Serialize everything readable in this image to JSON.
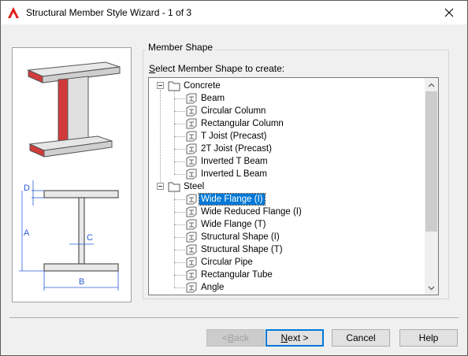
{
  "window": {
    "title": "Structural Member Style Wizard - 1 of 3",
    "close_glyph": "✕"
  },
  "preview": {
    "dimension_labels": {
      "d": "D",
      "a": "A",
      "c": "C",
      "b": "B"
    }
  },
  "group": {
    "title": "Member Shape",
    "list_label_prefix": "",
    "list_label_mnemonic": "S",
    "list_label_rest": "elect Member Shape to create:"
  },
  "tree": {
    "nodes": [
      {
        "label": "Concrete",
        "type": "category",
        "expanded": true
      },
      {
        "label": "Beam",
        "type": "shape"
      },
      {
        "label": "Circular Column",
        "type": "shape"
      },
      {
        "label": "Rectangular Column",
        "type": "shape"
      },
      {
        "label": "T Joist (Precast)",
        "type": "shape"
      },
      {
        "label": "2T Joist (Precast)",
        "type": "shape"
      },
      {
        "label": "Inverted T Beam",
        "type": "shape"
      },
      {
        "label": "Inverted L Beam",
        "type": "shape"
      },
      {
        "label": "Steel",
        "type": "category",
        "expanded": true
      },
      {
        "label": "Wide Flange (I)",
        "type": "shape",
        "selected": true
      },
      {
        "label": "Wide Reduced Flange (I)",
        "type": "shape"
      },
      {
        "label": "Wide Flange (T)",
        "type": "shape"
      },
      {
        "label": "Structural Shape (I)",
        "type": "shape"
      },
      {
        "label": "Structural Shape (T)",
        "type": "shape"
      },
      {
        "label": "Circular Pipe",
        "type": "shape"
      },
      {
        "label": "Rectangular Tube",
        "type": "shape"
      },
      {
        "label": "Angle",
        "type": "shape"
      }
    ],
    "selection_color": "#0078d7"
  },
  "buttons": {
    "back_prefix": "< ",
    "back_mnemonic": "B",
    "back_rest": "ack",
    "next_prefix": "",
    "next_mnemonic": "N",
    "next_rest": "ext >",
    "cancel": "Cancel",
    "help": "Help"
  },
  "colors": {
    "accent": "#0078d7",
    "beam_red": "#d23a3a",
    "dimension_blue": "#2a5bd7"
  }
}
